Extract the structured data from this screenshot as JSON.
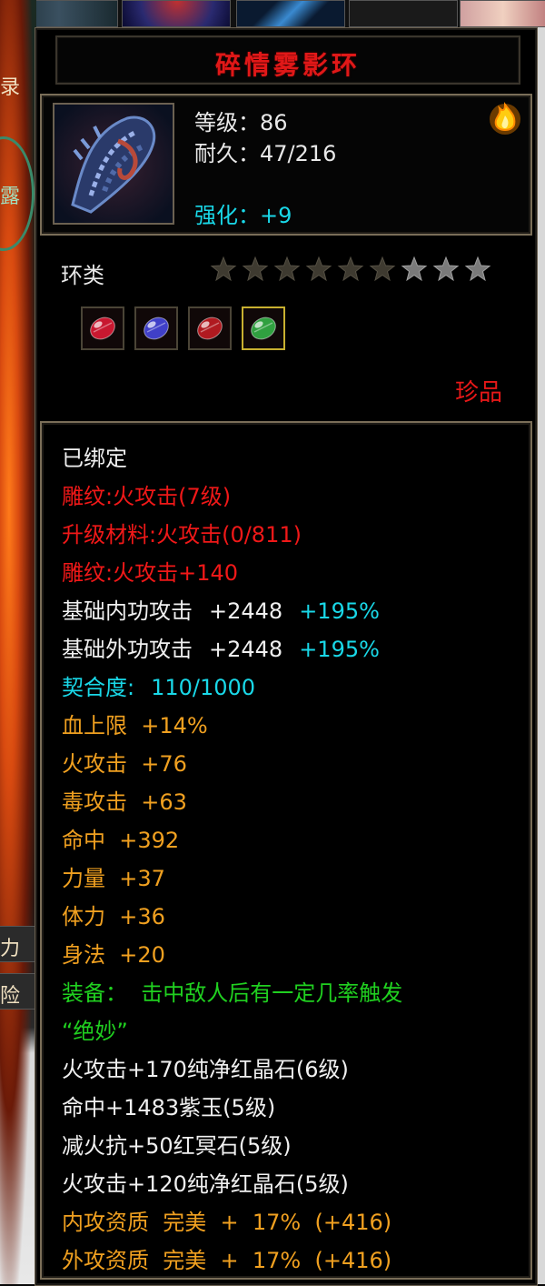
{
  "background": {
    "left_glyphs": [
      "录",
      "露",
      "力",
      "险"
    ]
  },
  "item": {
    "name": "碎情雾影环",
    "level": "等级：86",
    "durability": "耐久：47/216",
    "enhance": "强化：+9",
    "category": "环类",
    "stars_total": 9,
    "stars_filled": 6,
    "rarity": "珍品",
    "gems": [
      {
        "name": "red-gem-icon",
        "color": "#c81830"
      },
      {
        "name": "purple-gem-icon",
        "color": "#4040c8"
      },
      {
        "name": "red-gem-icon",
        "color": "#b01a20"
      },
      {
        "name": "green-gem-icon",
        "color": "#30a040"
      }
    ]
  },
  "details": {
    "bound": "已绑定",
    "engrave1": "雕纹:火攻击(7级)",
    "upgrade": "升级材料:火攻击(0/811)",
    "engrave2": "雕纹:火攻击+140",
    "base_inner_label": "基础内功攻击",
    "base_inner_value": "+2448",
    "base_inner_pct": "+195%",
    "base_outer_label": "基础外功攻击",
    "base_outer_value": "+2448",
    "base_outer_pct": "+195%",
    "fit_label": "契合度:",
    "fit_value": "110/1000",
    "attrs": [
      "血上限  +14%",
      "火攻击  +76",
      "毒攻击  +63",
      "命中  +392",
      "力量  +37",
      "体力  +36",
      "身法  +20"
    ],
    "equip_effect": "装备：  击中敌人后有一定几率触发",
    "equip_effect2": "“绝妙”",
    "sockets": [
      "火攻击+170纯净红晶石(6级)",
      "命中+1483紫玉(5级)",
      "减火抗+50红冥石(5级)",
      "火攻击+120纯净红晶石(5级)"
    ],
    "quality": [
      "内攻资质  完美  +  17%  (+416)",
      "外攻资质  完美  +  17%  (+416)"
    ]
  }
}
